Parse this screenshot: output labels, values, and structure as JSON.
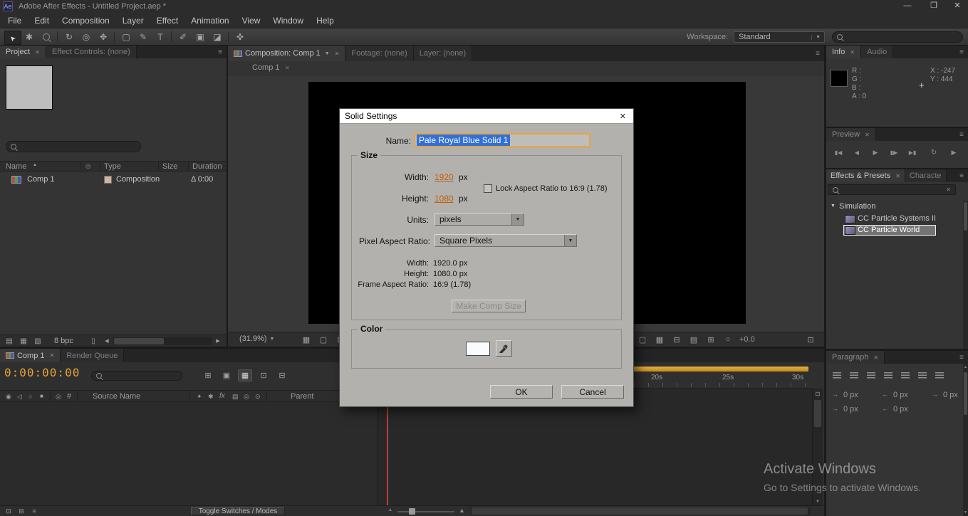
{
  "colors": {
    "hot_text": "#c25c07",
    "timecode": "#e8a23a",
    "selection_blue": "#3070d8",
    "focus_orange": "#e8a33d",
    "panel_bg": "#343434"
  },
  "icons": {
    "minimize": "—",
    "maximize": "❐",
    "close": "✕",
    "panel_menu": "≡",
    "dropdown": "▼",
    "dropdown_small": "▾",
    "tab_close": "✕",
    "sort_asc": "▲",
    "left": "◀",
    "right": "▶",
    "up": "▲",
    "down": "▼",
    "crosshair": "+",
    "tree_open": "▼",
    "hash": "#",
    "clear": "✕",
    "arrow_left": "←",
    "arrow_right": "→"
  },
  "titlebar": {
    "app_icon": "Ae",
    "title": "Adobe After Effects - Untitled Project.aep *"
  },
  "menubar": {
    "items": [
      "File",
      "Edit",
      "Composition",
      "Layer",
      "Effect",
      "Animation",
      "View",
      "Window",
      "Help"
    ]
  },
  "toolbar": {
    "tools": [
      {
        "name": "selection-tool",
        "glyph": "➤"
      },
      {
        "name": "hand-tool",
        "glyph": "✱"
      },
      {
        "name": "zoom-tool",
        "glyph": ""
      },
      {
        "name": "rotation-tool",
        "glyph": "↻"
      },
      {
        "name": "camera-tool",
        "glyph": "◎"
      },
      {
        "name": "pan-behind-tool",
        "glyph": "✥"
      },
      {
        "name": "shape-tool",
        "glyph": "▢"
      },
      {
        "name": "pen-tool",
        "glyph": "✎"
      },
      {
        "name": "type-tool",
        "glyph": "T"
      },
      {
        "name": "brush-tool",
        "glyph": "✐"
      },
      {
        "name": "clone-stamp-tool",
        "glyph": "▣"
      },
      {
        "name": "eraser-tool",
        "glyph": "◪"
      },
      {
        "name": "puppet-pin-tool",
        "glyph": "✜"
      }
    ],
    "workspace_label": "Workspace:",
    "workspace_value": "Standard"
  },
  "project": {
    "tabs": [
      "Project",
      "Effect Controls: (none)"
    ],
    "columns": [
      "Name",
      "Type",
      "Size",
      "Duration"
    ],
    "label_col_icon": "◎",
    "rows": [
      {
        "name": "Comp 1",
        "type": "Composition",
        "duration": "Δ 0:00"
      }
    ],
    "bpc": "8 bpc",
    "bottom_icons": [
      "▤",
      "▦",
      "▧"
    ],
    "trash_icon": "▯"
  },
  "comp": {
    "tabs": [
      "Composition: Comp 1",
      "Footage: (none)",
      "Layer: (none)"
    ],
    "subtab": "Comp 1",
    "zoom": "(31.9%)",
    "exposure": "+0.0",
    "bottom_icons_left": [
      "▦",
      "▢",
      "⊞",
      "▣"
    ],
    "bottom_icons_right": [
      "▢",
      "▦",
      "⊟",
      "▤",
      "⊞",
      "○"
    ],
    "bottom_icon_end": "⊡"
  },
  "dialog": {
    "title": "Solid Settings",
    "name_label": "Name:",
    "name_value": "Pale Royal Blue Solid 1",
    "size": {
      "group_label": "Size",
      "width_label": "Width:",
      "width_value": "1920",
      "width_unit": "px",
      "height_label": "Height:",
      "height_value": "1080",
      "height_unit": "px",
      "lock_label": "Lock Aspect Ratio to 16:9 (1.78)",
      "units_label": "Units:",
      "units_value": "pixels",
      "par_label": "Pixel Aspect Ratio:",
      "par_value": "Square Pixels",
      "info": [
        {
          "label": "Width:",
          "value": "1920.0 px"
        },
        {
          "label": "Height:",
          "value": "1080.0 px"
        },
        {
          "label": "Frame Aspect Ratio:",
          "value": "16:9 (1.78)"
        }
      ],
      "make_comp_size": "Make Comp Size"
    },
    "color": {
      "group_label": "Color"
    },
    "ok": "OK",
    "cancel": "Cancel"
  },
  "info": {
    "tabs": [
      "Info",
      "Audio"
    ],
    "channels": [
      "R :",
      "G :",
      "B :",
      "A : 0"
    ],
    "x": "X : -247",
    "y": "Y : 444"
  },
  "preview": {
    "tab": "Preview",
    "buttons": [
      "▮◀",
      "◀",
      "▶",
      "▮▶",
      "▶▮",
      "↻",
      "▶"
    ]
  },
  "effects": {
    "tabs": [
      "Effects & Presets",
      "Characte"
    ],
    "folder": "Simulation",
    "items": [
      "CC Particle Systems II",
      "CC Particle World"
    ]
  },
  "paragraph": {
    "tab": "Paragraph",
    "fields": [
      "0 px",
      "0 px",
      "0 px",
      "0 px",
      "0 px"
    ]
  },
  "timeline": {
    "tabs": [
      "Comp 1",
      "Render Queue"
    ],
    "timecode": "0:00:00:00",
    "tool_icons": [
      "⊞",
      "▣",
      "▦",
      "⊡",
      "⊟"
    ],
    "left_icons": [
      "◉",
      "◁",
      "○",
      "■"
    ],
    "label_col_icon": "◎",
    "header": {
      "source_name": "Source Name",
      "parent": "Parent"
    },
    "switch_icons": [
      "✦",
      "✱",
      "fx",
      "▤",
      "◎",
      "⊙"
    ],
    "ruler": [
      "20s",
      "25s",
      "30s"
    ],
    "bottom_left_icons": [
      "⊡",
      "⊟",
      "≡"
    ],
    "toggle_button": "Toggle Switches / Modes"
  },
  "watermark": {
    "line1": "Activate Windows",
    "line2": "Go to Settings to activate Windows."
  }
}
